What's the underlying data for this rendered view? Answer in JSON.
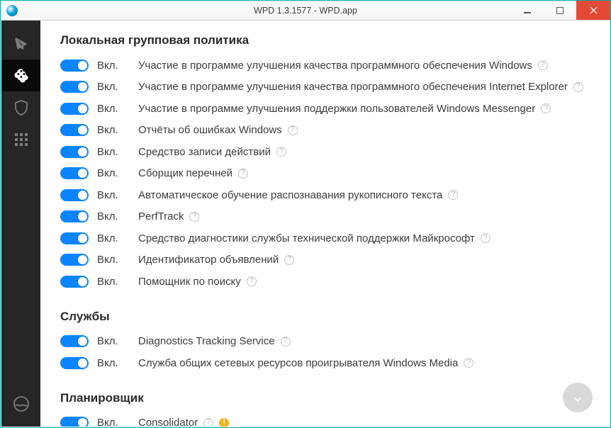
{
  "window": {
    "title": "WPD 1.3.1577 - WPD.app"
  },
  "sections": {
    "s1": {
      "title": "Локальная групповая политика"
    },
    "s2": {
      "title": "Службы"
    },
    "s3": {
      "title": "Планировщик"
    }
  },
  "state_on": "Вкл.",
  "items": {
    "gp": [
      {
        "desc": "Участие в программе улучшения качества программного обеспечения Windows",
        "help": true
      },
      {
        "desc": "Участие в программе улучшения качества программного обеспечения Internet Explorer",
        "help": true
      },
      {
        "desc": "Участие в программе улучшения поддержки пользователей Windows Messenger",
        "help": true
      },
      {
        "desc": "Отчёты об ошибках Windows",
        "help": true
      },
      {
        "desc": "Средство записи действий",
        "help": true
      },
      {
        "desc": "Сборщик перечней",
        "help": true
      },
      {
        "desc": "Автоматическое обучение распознавания рукописного текста",
        "help": true
      },
      {
        "desc": "PerfTrack",
        "help": true
      },
      {
        "desc": "Средство диагностики службы технической поддержки Майкрософт",
        "help": true
      },
      {
        "desc": "Идентификатор объявлений",
        "help": true
      },
      {
        "desc": "Помощник по поиску",
        "help": true
      }
    ],
    "svc": [
      {
        "desc": "Diagnostics Tracking Service",
        "help": true
      },
      {
        "desc": "Служба общих сетевых ресурсов проигрывателя Windows Media",
        "help": true
      }
    ],
    "sch": [
      {
        "desc": "Consolidator",
        "help": true,
        "warn": true
      }
    ]
  }
}
